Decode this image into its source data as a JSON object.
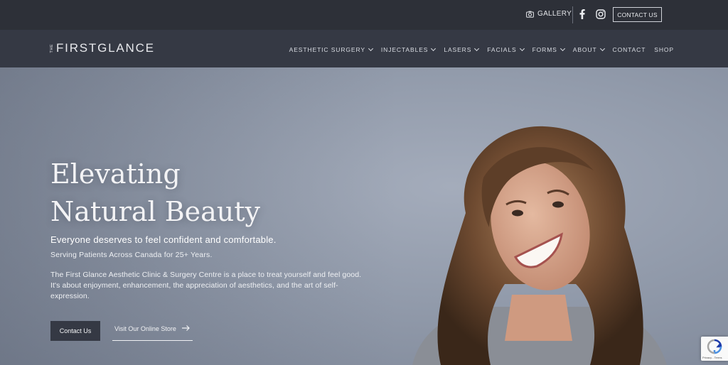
{
  "topbar": {
    "gallery_label": "GALLERY",
    "gallery_icon": "camera-icon",
    "facebook_icon": "facebook-icon",
    "instagram_icon": "instagram-icon",
    "contact_button": "CONTACT US"
  },
  "logo": {
    "prefix": "THE",
    "brand": "FIRSTGLANCE"
  },
  "nav": {
    "items": [
      {
        "label": "AESTHETIC SURGERY",
        "dropdown": true
      },
      {
        "label": "INJECTABLES",
        "dropdown": true
      },
      {
        "label": "LASERS",
        "dropdown": true
      },
      {
        "label": "FACIALS",
        "dropdown": true
      },
      {
        "label": "FORMS",
        "dropdown": true
      },
      {
        "label": "ABOUT",
        "dropdown": true
      },
      {
        "label": "CONTACT",
        "dropdown": false
      },
      {
        "label": "SHOP",
        "dropdown": false
      }
    ]
  },
  "hero": {
    "headline_line1": "Elevating",
    "headline_line2": "Natural Beauty",
    "tagline": "Everyone deserves to feel confident and comfortable.",
    "subtagline": "Serving Patients Across Canada for 25+ Years.",
    "description": "The First Glance Aesthetic Clinic & Surgery Centre is a place to treat yourself and feel good. It's about enjoyment, enhancement, the appreciation of aesthetics, and the art of self-expression.",
    "primary_button": "Contact Us",
    "secondary_button": "Visit Our Online Store"
  },
  "recaptcha": {
    "text": "Privacy - Terms"
  },
  "colors": {
    "topbar": "#2d3038",
    "navbar": "#353944",
    "hero_bg": "#929bab",
    "button_dark": "#353944"
  }
}
